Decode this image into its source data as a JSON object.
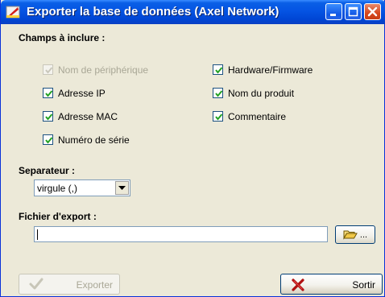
{
  "window": {
    "title": "Exporter la base de données (Axel Network)"
  },
  "include": {
    "label": "Champs à inclure :",
    "fields": [
      {
        "label": "Nom de périphérique",
        "checked": true,
        "enabled": false
      },
      {
        "label": "Adresse IP",
        "checked": true,
        "enabled": true
      },
      {
        "label": "Adresse MAC",
        "checked": true,
        "enabled": true
      },
      {
        "label": "Numéro de série",
        "checked": true,
        "enabled": true
      },
      {
        "label": "Hardware/Firmware",
        "checked": true,
        "enabled": true
      },
      {
        "label": "Nom du produit",
        "checked": true,
        "enabled": true
      },
      {
        "label": "Commentaire",
        "checked": true,
        "enabled": true
      }
    ]
  },
  "separator": {
    "label": "Separateur :",
    "selected": "virgule (,)"
  },
  "export_file": {
    "label": "Fichier d'export :",
    "value": "",
    "browse_label": "..."
  },
  "buttons": {
    "export_label": "Exporter",
    "exit_label": "Sortir"
  },
  "icons": {
    "app": "app-icon",
    "minimize": "minimize-icon",
    "maximize": "maximize-icon",
    "close": "close-icon",
    "folder": "folder-open-icon",
    "export": "checkmark-icon",
    "exit": "red-x-icon"
  },
  "colors": {
    "titlebar": "#0554e3",
    "face": "#ece9d8",
    "disabled_text": "#a9a796",
    "exit_x": "#b01010"
  }
}
